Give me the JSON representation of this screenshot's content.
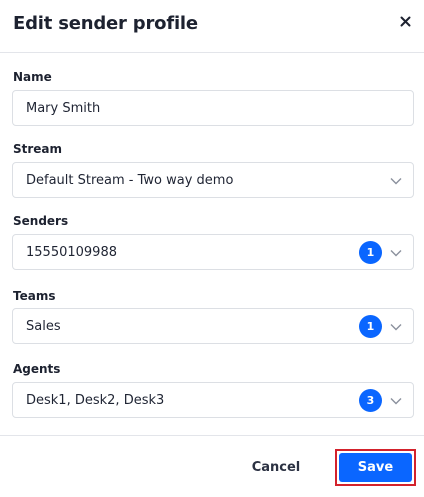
{
  "dialog": {
    "title": "Edit sender profile",
    "close_icon": "close-icon"
  },
  "fields": {
    "name": {
      "label": "Name",
      "value": "Mary Smith"
    },
    "stream": {
      "label": "Stream",
      "value": "Default Stream - Two way demo"
    },
    "senders": {
      "label": "Senders",
      "value": "15550109988",
      "count": "1"
    },
    "teams": {
      "label": "Teams",
      "value": "Sales",
      "count": "1"
    },
    "agents": {
      "label": "Agents",
      "value": "Desk1, Desk2, Desk3",
      "count": "3"
    }
  },
  "footer": {
    "cancel_label": "Cancel",
    "save_label": "Save"
  },
  "colors": {
    "accent": "#0a66ff",
    "highlight_outline": "#d3222c"
  }
}
